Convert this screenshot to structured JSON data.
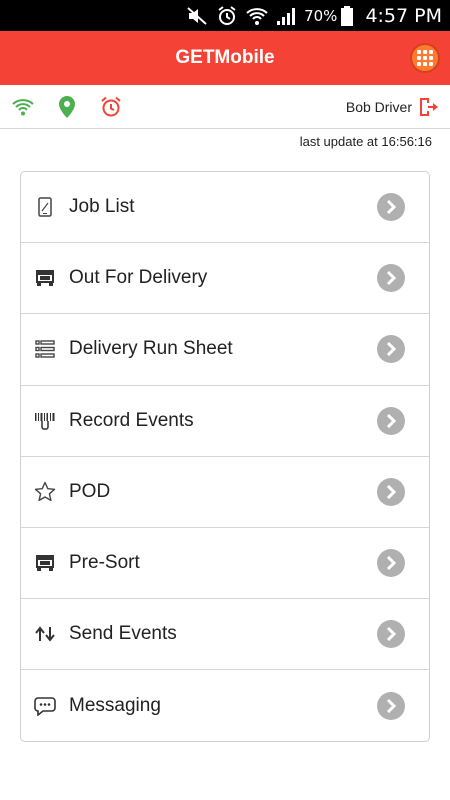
{
  "status_bar": {
    "battery_percent": "70%",
    "time": "4:57 PM"
  },
  "app_bar": {
    "title": "GETMobile",
    "color": "#f44336"
  },
  "info_bar": {
    "icons": [
      "wifi-icon",
      "location-pin-icon",
      "alarm-clock-icon"
    ],
    "icon_colors": {
      "wifi": "#4caf50",
      "location": "#4caf50",
      "alarm": "#f44336"
    },
    "user_name": "Bob Driver"
  },
  "last_update": "last update at 16:56:16",
  "menu": {
    "items": [
      {
        "label": "Job List",
        "icon": "phone-icon"
      },
      {
        "label": "Out For Delivery",
        "icon": "truck-icon"
      },
      {
        "label": "Delivery Run Sheet",
        "icon": "list-icon"
      },
      {
        "label": "Record Events",
        "icon": "barcode-scan-icon"
      },
      {
        "label": "POD",
        "icon": "star-icon"
      },
      {
        "label": "Pre-Sort",
        "icon": "truck-icon"
      },
      {
        "label": "Send Events",
        "icon": "up-down-arrows-icon"
      },
      {
        "label": "Messaging",
        "icon": "chat-bubble-icon"
      }
    ]
  }
}
